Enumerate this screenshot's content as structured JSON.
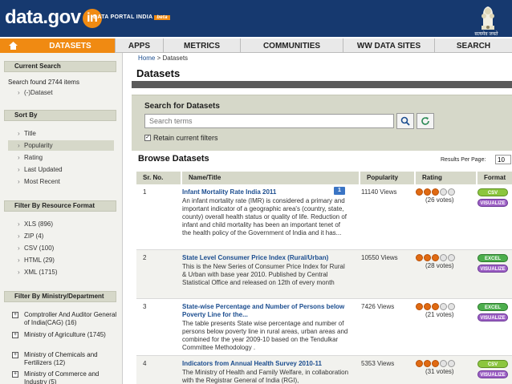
{
  "header": {
    "logo_text": "data.gov",
    "logo_in": "in",
    "portal_label": "DATA PORTAL INDIA",
    "beta": "beta",
    "emblem_caption": "सत्यमेव जयते"
  },
  "nav": {
    "items": [
      "DATASETS",
      "APPS",
      "METRICS",
      "COMMUNITIES",
      "WW DATA SITES",
      "SEARCH"
    ]
  },
  "sidebar": {
    "current_search_head": "Current Search",
    "search_found": "Search found 2744 items",
    "dataset_filter": "(-)Dataset",
    "sort_by_head": "Sort By",
    "sort_items": [
      "Title",
      "Popularity",
      "Rating",
      "Last Updated",
      "Most Recent"
    ],
    "resource_head": "Filter By Resource Format",
    "resource_items": [
      "XLS (896)",
      "ZIP (4)",
      "CSV (100)",
      "HTML (29)",
      "XML (1715)"
    ],
    "ministry_head": "Filter By Ministry/Department",
    "ministry_items": [
      "Comptroller And Auditor General of India(CAG) (16)",
      "Ministry of Agriculture (1745)",
      "Ministry of Chemicals and Fertilizers (12)",
      "Ministry of Commerce and Industry (5)"
    ]
  },
  "main": {
    "breadcrumb_home": "Home",
    "breadcrumb_sep": ">",
    "breadcrumb_current": "Datasets",
    "page_title": "Datasets",
    "search_title": "Search for Datasets",
    "search_placeholder": "Search terms",
    "retain_label": "Retain current filters",
    "browse_title": "Browse Datasets",
    "results_per_page_label": "Results Per Page:",
    "results_per_page_value": "10",
    "columns": [
      "Sr. No.",
      "Name/Title",
      "Popularity",
      "Rating",
      "Format"
    ],
    "rows": [
      {
        "sr": "1",
        "title": "Infant Mortality Rate India 2011",
        "badge": "1",
        "description": "An infant mortality rate (IMR) is considered a primary and important indicator of a geographic area's (country, state, county) overall health status or quality of life. Reduction of infant and child mortality has been an important tenet of the health policy of the Government of India and it has...",
        "popularity": "11140 Views",
        "rating": 3,
        "votes": "(26 votes)",
        "formats": [
          "CSV",
          "VISUALIZE"
        ]
      },
      {
        "sr": "2",
        "title": "State Level Consumer Price Index (Rural/Urban)",
        "description": "This is the New Series of Consumer Price Index for Rural & Urban with base year 2010. Published by Central Statistical Office and released on 12th of every month",
        "popularity": "10550 Views",
        "rating": 3,
        "votes": "(28 votes)",
        "formats": [
          "EXCEL",
          "VISUALIZE"
        ]
      },
      {
        "sr": "3",
        "title": "State-wise Percentage and Number of Persons below Poverty Line for the...",
        "description": "The table presents State wise percentage and number of persons below poverty line in rural areas, urban areas and combined for the year 2009-10 based on the Tendulkar Committee Methodology .",
        "popularity": "7426 Views",
        "rating": 3,
        "votes": "(21 votes)",
        "formats": [
          "EXCEL",
          "VISUALIZE"
        ]
      },
      {
        "sr": "4",
        "title": "Indicators from Annual Health Survey 2010-11",
        "description": "The Ministry of Health and Family Welfare, in collaboration with the Registrar General of India (RGI),",
        "popularity": "5353 Views",
        "rating": 3,
        "votes": "(31 votes)",
        "formats": [
          "CSV",
          "VISUALIZE"
        ]
      }
    ]
  },
  "colors": {
    "header_bg": "#16396f",
    "accent": "#f08a12",
    "panel": "#d6d8c9",
    "link": "#1b4d8f"
  }
}
